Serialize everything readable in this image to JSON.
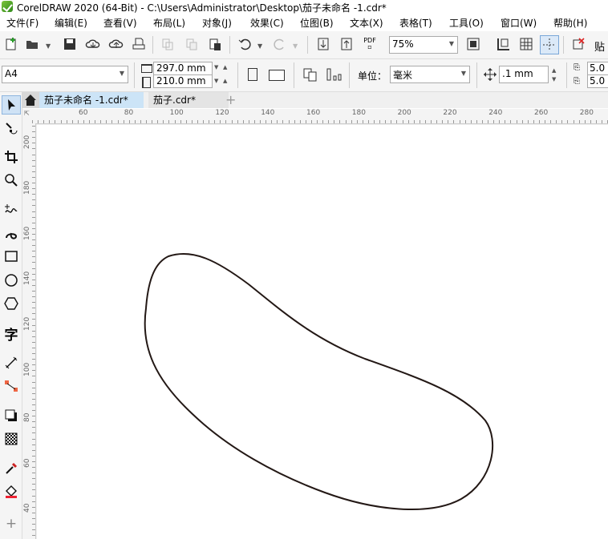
{
  "window": {
    "title": "CorelDRAW 2020 (64-Bit) - C:\\Users\\Administrator\\Desktop\\茄子未命名 -1.cdr*"
  },
  "menu": [
    "文件(F)",
    "编辑(E)",
    "查看(V)",
    "布局(L)",
    "对象(J)",
    "效果(C)",
    "位图(B)",
    "文本(X)",
    "表格(T)",
    "工具(O)",
    "窗口(W)",
    "帮助(H)"
  ],
  "toolbar": {
    "zoom": "75%",
    "pdf_label": "PDF",
    "paste_label": "贴"
  },
  "propbar": {
    "page_size": "A4",
    "width": "297.0 mm",
    "height": "210.0 mm",
    "units_label": "单位：",
    "units_value": "毫米",
    "nudge": ".1 mm",
    "dup_x": "5.0 r",
    "dup_y": "5.0 r"
  },
  "tabs": [
    {
      "label": "茄子未命名 -1.cdr*",
      "active": true
    },
    {
      "label": "茄子.cdr*",
      "active": false
    }
  ],
  "hruler_labels": [
    "60",
    "80",
    "100",
    "120",
    "140",
    "160",
    "180",
    "200",
    "220",
    "240",
    "260",
    "280"
  ],
  "vruler_labels": [
    "200",
    "180",
    "160",
    "140",
    "120",
    "100",
    "80",
    "60",
    "40"
  ],
  "colors": {
    "accent": "#cce4f7",
    "outline": "#231815"
  }
}
